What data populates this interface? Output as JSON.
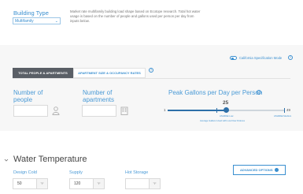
{
  "building_type": {
    "label": "Building Type",
    "selected": "Multifamily"
  },
  "description": "Market rate multifamily building load shape based on Ecotope research. Total hot water usage is based on the number of people and gallons used per person per day from inputs below.",
  "spec_mode": {
    "label": "California Specification Mode",
    "help": "?"
  },
  "tabs": [
    {
      "label": "TOTAL PEOPLE & APARTMENTS"
    },
    {
      "label": "APARTMENT SIZE & OCCUPANCY RATES"
    }
  ],
  "tab_help": "?",
  "fields": {
    "people_label_line1": "Number of",
    "people_label_line2": "people",
    "people_value": "",
    "apartments_label_line1": "Number of",
    "apartments_label_line2": "apartments",
    "apartments_value": ""
  },
  "gallons": {
    "title": "Peak Gallons per Day per Person",
    "help": "?",
    "value": "25",
    "min": "1",
    "max": "49",
    "value_fraction": 0.5,
    "ticks": [
      {
        "label": "Average Gallons Used with Low Flow Fixtures",
        "fraction": 0.42
      },
      {
        "label": "ASHRAE Low",
        "fraction": 0.5
      },
      {
        "label": "ASHRAE Medium",
        "fraction": 1.0
      }
    ]
  },
  "water_temperature": {
    "title": "Water Temperature",
    "advanced_button": "ADVANCED OPTIONS",
    "fields": [
      {
        "label": "Design Cold",
        "value": "50",
        "unit": "°F"
      },
      {
        "label": "Supply",
        "value": "120",
        "unit": "°F"
      },
      {
        "label": "Hot Storage",
        "value": "",
        "unit": "°F"
      }
    ]
  },
  "colors": {
    "accent": "#3a8fd0",
    "slider": "#2d6fa8",
    "panel": "#f7f7f7",
    "tab_active": "#5a5f66"
  }
}
